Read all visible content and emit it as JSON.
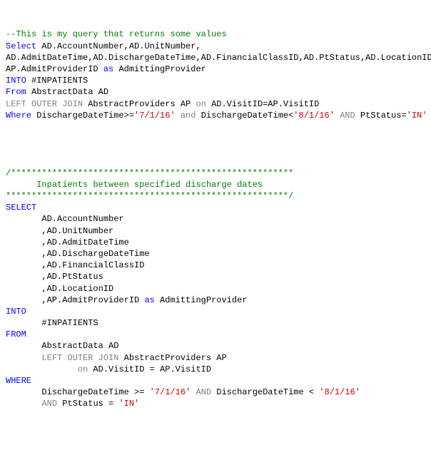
{
  "q1": {
    "comment": "--This is my query that returns some values",
    "l1_select": "Select",
    "l1_cols": " AD.AccountNumber,AD.UnitNumber,",
    "l2_cols": "AD.AdmitDateTime,AD.DischargeDateTime,AD.FinancialClassID,AD.PtStatus,AD.LocationID,",
    "l3_col": "AP.AdmitProviderID ",
    "l3_as": "as",
    "l3_alias": " AdmittingProvider",
    "l4_into": "INTO",
    "l4_tbl": " #INPATIENTS",
    "l5_from": "From",
    "l5_tbl": " AbstractData AD",
    "l6_join": "LEFT OUTER JOIN",
    "l6_j1": " AbstractProviders AP ",
    "l6_on": "on",
    "l6_pred": " AD.VisitID=AP.VisitID",
    "l7_where": "Where",
    "l7_p1": " DischargeDateTime>=",
    "l7_s1": "'7/1/16'",
    "l7_and1": " and",
    "l7_p2": " DischargeDateTime<",
    "l7_s2": "'8/1/16'",
    "l7_and2": " AND",
    "l7_p3": " PtStatus=",
    "l7_s3": "'IN'"
  },
  "q2": {
    "cstar1": "/*******************************************************",
    "ctitle_indent": "      ",
    "ctitle": "Inpatients between specified discharge dates",
    "cstar2": "*******************************************************/",
    "select": "SELECT",
    "c1": "       AD.AccountNumber",
    "c2": "       ,AD.UnitNumber",
    "c3": "       ,AD.AdmitDateTime",
    "c4": "       ,AD.DischargeDateTime",
    "c5": "       ,AD.FinancialClassID",
    "c6": "       ,AD.PtStatus",
    "c7": "       ,AD.LocationID",
    "c8_a": "       ,AP.AdmitProviderID ",
    "c8_as": "as",
    "c8_b": " AdmittingProvider",
    "into": "INTO",
    "into_tbl": "       #INPATIENTS",
    "from": "FROM",
    "from_tbl": "       AbstractData AD",
    "join_ind": "       ",
    "join_kw": "LEFT OUTER JOIN",
    "join_tbl": " AbstractProviders AP",
    "on_ind": "              ",
    "on_kw": "on",
    "on_pred": " AD.VisitID = AP.VisitID",
    "where": "WHERE",
    "w1_ind": "       ",
    "w1_a": "DischargeDateTime >= ",
    "w1_s1": "'7/1/16'",
    "w1_and": " AND",
    "w1_b": " DischargeDateTime < ",
    "w1_s2": "'8/1/16'",
    "w2_ind": "       ",
    "w2_and": "AND",
    "w2_a": " PtStatus = ",
    "w2_s": "'IN'"
  }
}
